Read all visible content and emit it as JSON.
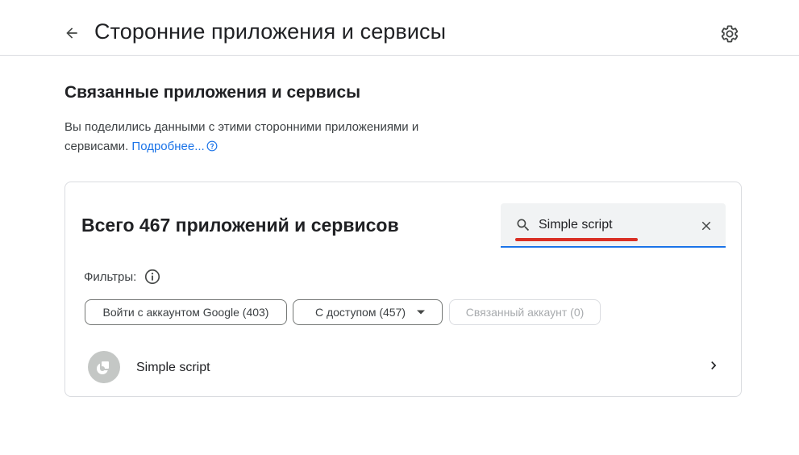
{
  "header": {
    "title": "Сторонние приложения и сервисы"
  },
  "section": {
    "title": "Связанные приложения и сервисы",
    "description": "Вы поделились данными с этими сторонними приложениями и сервисами.",
    "learn_more": "Подробнее..."
  },
  "card": {
    "title": "Всего 467 приложений и сервисов",
    "search": {
      "value": "Simple script"
    },
    "filters_label": "Фильтры:",
    "chips": {
      "google": "Войти с аккаунтом Google (403)",
      "access": "С доступом (457)",
      "linked": "Связанный аккаунт (0)"
    },
    "apps": [
      {
        "name": "Simple script"
      }
    ]
  },
  "colors": {
    "accent": "#1a73e8",
    "annotation_underline": "#d93025"
  },
  "icons": [
    "back-arrow-icon",
    "gear-icon",
    "help-circle-icon",
    "search-icon",
    "close-icon",
    "info-icon",
    "dropdown-arrow-icon",
    "app-logo-icon",
    "chevron-right-icon"
  ]
}
